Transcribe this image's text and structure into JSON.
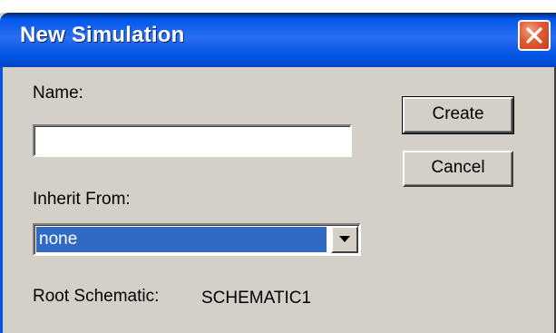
{
  "window": {
    "title": "New Simulation",
    "close_icon": "close-icon"
  },
  "form": {
    "name_label": "Name:",
    "name_value": "",
    "inherit_label": "Inherit From:",
    "inherit_selected": "none",
    "root_label": "Root Schematic:",
    "root_value": "SCHEMATIC1"
  },
  "buttons": {
    "create_label": "Create",
    "cancel_label": "Cancel"
  },
  "colors": {
    "title_bar": "#0054e3",
    "dialog_bg": "#d4d0c8",
    "selection": "#316ac5",
    "close_button": "#e05a34"
  }
}
